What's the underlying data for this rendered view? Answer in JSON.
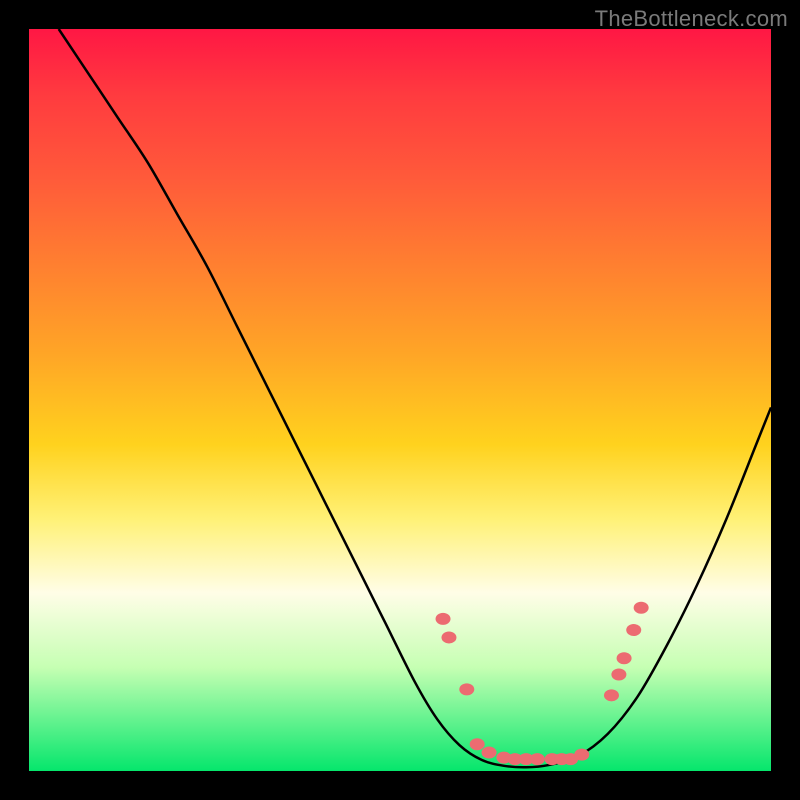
{
  "watermark": "TheBottleneck.com",
  "colors": {
    "background": "#000000",
    "gradient_top": "#ff1744",
    "gradient_bottom": "#05e66c",
    "curve": "#000000",
    "dot": "#ec6b71"
  },
  "chart_data": {
    "type": "line",
    "title": "",
    "xlabel": "",
    "ylabel": "",
    "xlim": [
      0,
      100
    ],
    "ylim": [
      0,
      100
    ],
    "curve": {
      "x": [
        4,
        8,
        12,
        16,
        20,
        24,
        28,
        32,
        36,
        40,
        44,
        48,
        52,
        55,
        58,
        61,
        64,
        67,
        70,
        74,
        78,
        82,
        86,
        90,
        94,
        98,
        100
      ],
      "y": [
        100,
        94,
        88,
        82,
        75,
        68,
        60,
        52,
        44,
        36,
        28,
        20,
        12,
        7,
        3.5,
        1.5,
        0.7,
        0.5,
        0.8,
        2,
        5,
        10,
        17,
        25,
        34,
        44,
        49
      ]
    },
    "dots": [
      {
        "x": 55.8,
        "y": 20.5
      },
      {
        "x": 56.6,
        "y": 18.0
      },
      {
        "x": 59.0,
        "y": 11.0
      },
      {
        "x": 60.4,
        "y": 3.6
      },
      {
        "x": 62.0,
        "y": 2.5
      },
      {
        "x": 64.0,
        "y": 1.8
      },
      {
        "x": 65.5,
        "y": 1.6
      },
      {
        "x": 67.0,
        "y": 1.6
      },
      {
        "x": 68.5,
        "y": 1.6
      },
      {
        "x": 70.5,
        "y": 1.6
      },
      {
        "x": 71.8,
        "y": 1.6
      },
      {
        "x": 73.0,
        "y": 1.6
      },
      {
        "x": 74.5,
        "y": 2.2
      },
      {
        "x": 78.5,
        "y": 10.2
      },
      {
        "x": 79.5,
        "y": 13.0
      },
      {
        "x": 80.2,
        "y": 15.2
      },
      {
        "x": 81.5,
        "y": 19.0
      },
      {
        "x": 82.5,
        "y": 22.0
      }
    ]
  }
}
